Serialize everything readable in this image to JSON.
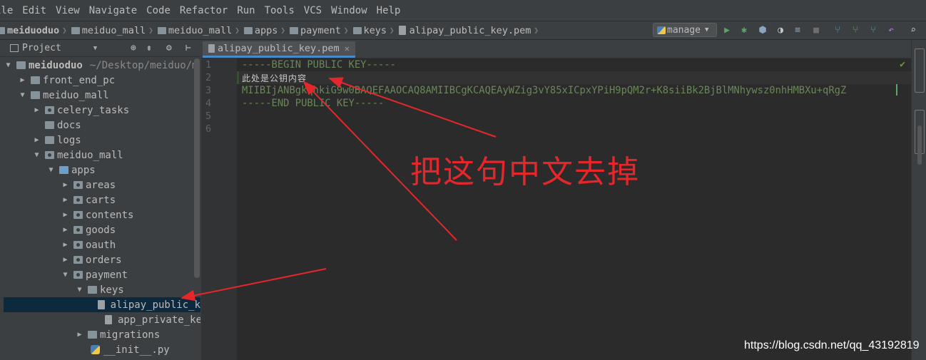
{
  "menu": [
    "ile",
    "Edit",
    "View",
    "Navigate",
    "Code",
    "Refactor",
    "Run",
    "Tools",
    "VCS",
    "Window",
    "Help"
  ],
  "breadcrumbs": [
    "meiduoduo",
    "meiduo_mall",
    "meiduo_mall",
    "apps",
    "payment",
    "keys",
    "alipay_public_key.pem"
  ],
  "run_config": "manage",
  "project_panel": {
    "title": "Project",
    "root_name": "meiduoduo",
    "root_path": "~/Desktop/meiduo/m",
    "tree": [
      {
        "label": "front_end_pc"
      },
      {
        "label": "meiduo_mall"
      },
      {
        "label": "celery_tasks"
      },
      {
        "label": "docs"
      },
      {
        "label": "logs"
      },
      {
        "label": "meiduo_mall"
      },
      {
        "label": "apps"
      },
      {
        "label": "areas"
      },
      {
        "label": "carts"
      },
      {
        "label": "contents"
      },
      {
        "label": "goods"
      },
      {
        "label": "oauth"
      },
      {
        "label": "orders"
      },
      {
        "label": "payment"
      },
      {
        "label": "keys"
      },
      {
        "label": "alipay_public_k"
      },
      {
        "label": "app_private_key"
      },
      {
        "label": "migrations"
      },
      {
        "label": "__init__.py"
      }
    ]
  },
  "editor": {
    "tab_label": "alipay_public_key.pem",
    "line_numbers": [
      "1",
      "2",
      "3",
      "4",
      "5",
      "6"
    ],
    "lines": [
      "-----BEGIN PUBLIC KEY-----",
      "此处是公钥内容",
      "MIIBIjANBgkqhkiG9w0BAQEFAAOCAQ8AMIIBCgKCAQEAyWZig3vY85xICpxYPiH9pQM2r+K8siiBk2BjBlMNhywsz0nhHMBXu+qRgZ",
      "-----END PUBLIC KEY-----"
    ]
  },
  "annotation": "把这句中文去掉",
  "watermark": "https://blog.csdn.net/qq_43192819",
  "colors": {
    "annotation_red": "#e5272c",
    "code_green": "#6a8759",
    "selection_blue": "#0d293e"
  }
}
